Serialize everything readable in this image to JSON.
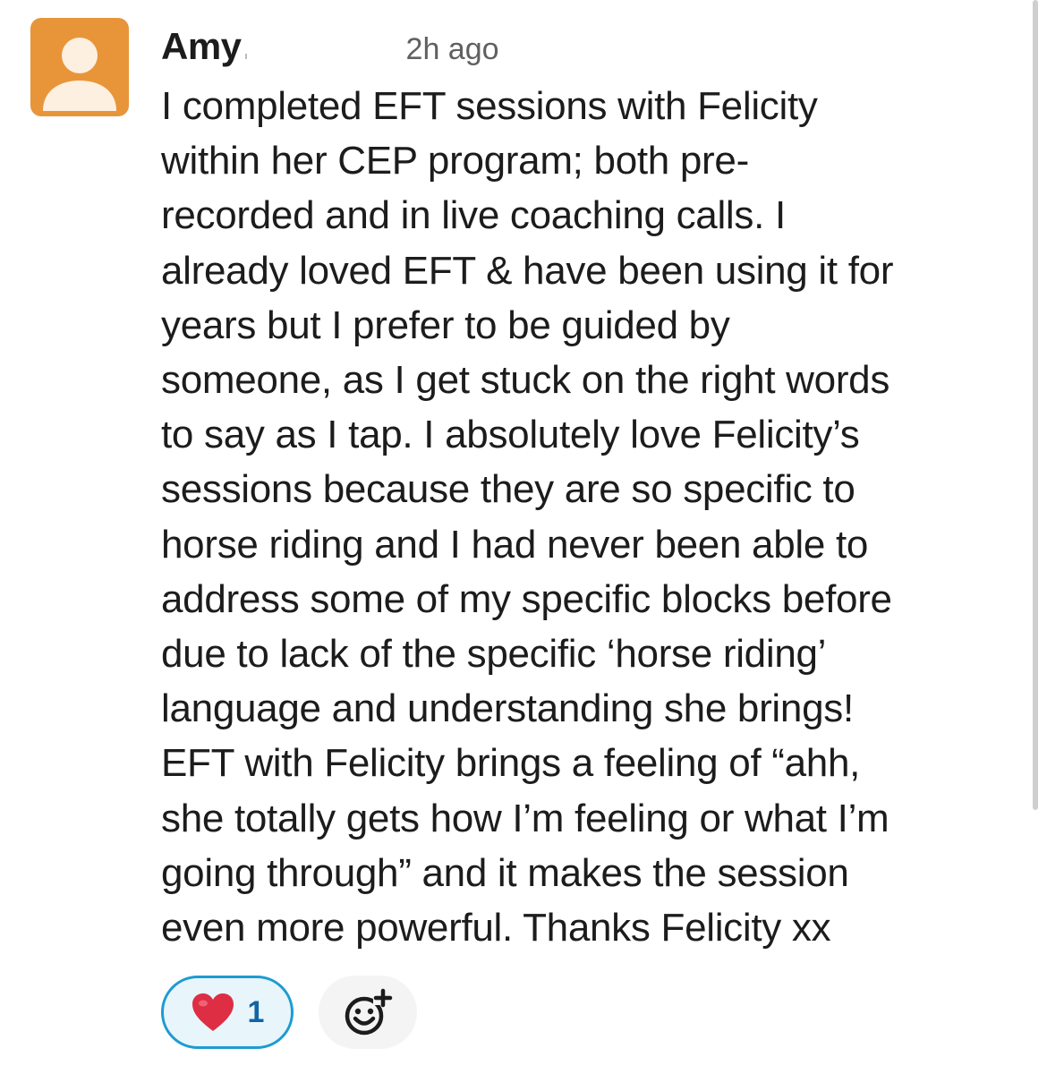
{
  "message": {
    "author": "Amy",
    "timestamp": "2h ago",
    "lines": [
      "I completed EFT sessions with Felicity",
      "within her CEP program; both pre-",
      "recorded and in live coaching calls. I",
      "already loved EFT & have been using it for",
      "years but I prefer to be guided by",
      "someone, as I get stuck on the right words",
      "to say as I tap. I absolutely love Felicity’s",
      "sessions because they are so specific to",
      "horse riding and I had never been able to",
      "address some of my specific blocks before",
      "due to lack of the specific ‘horse riding’",
      "language and understanding she brings!",
      "EFT with Felicity brings a feeling of “ahh,",
      "she totally gets how I’m feeling or what I’m",
      "going through” and it makes the session",
      "even more powerful. Thanks Felicity xx"
    ]
  },
  "avatar": {
    "icon": "default-user-avatar-icon",
    "color": "#E8953A"
  },
  "reactions": {
    "heart": {
      "icon": "red-heart-icon",
      "count": "1",
      "highlight_color": "#1D9BD1"
    },
    "add_reaction_icon": "add-emoji-reaction-icon"
  }
}
